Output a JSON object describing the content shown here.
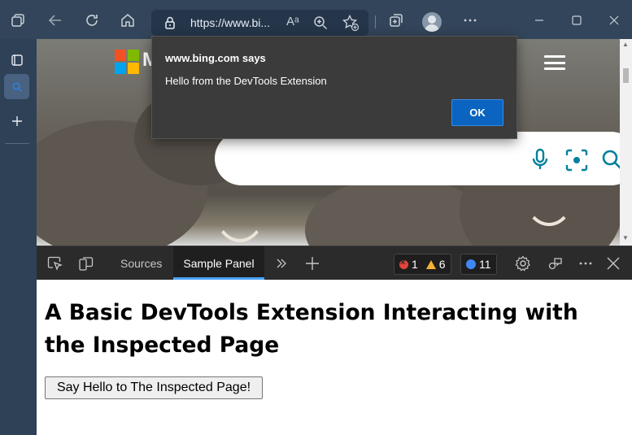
{
  "browser": {
    "url": "https://www.bi...",
    "read_aloud_label": "Aᵃ",
    "icons": [
      "workspaces-icon",
      "back-icon",
      "refresh-icon",
      "home-icon",
      "lock-icon",
      "read-aloud-icon",
      "zoom-icon",
      "add-favorite-icon",
      "collections-icon",
      "profile-avatar",
      "more-icon",
      "minimize-icon",
      "maximize-icon",
      "close-icon"
    ]
  },
  "dialog": {
    "title": "www.bing.com says",
    "message": "Hello from the DevTools Extension",
    "ok_label": "OK"
  },
  "bing": {
    "logo_letter": "M",
    "logo_colors": [
      "#f25022",
      "#7fba00",
      "#00a4ef",
      "#ffb900"
    ],
    "accent": "#00809d"
  },
  "devtools": {
    "tabs": [
      {
        "label": "Sources",
        "active": false
      },
      {
        "label": "Sample Panel",
        "active": true
      }
    ],
    "errors": "1",
    "warnings": "6",
    "messages": "11",
    "accent": "#4ba3f7"
  },
  "panel": {
    "heading": "A Basic DevTools Extension Interacting with the Inspected Page",
    "button_label": "Say Hello to The Inspected Page!"
  }
}
